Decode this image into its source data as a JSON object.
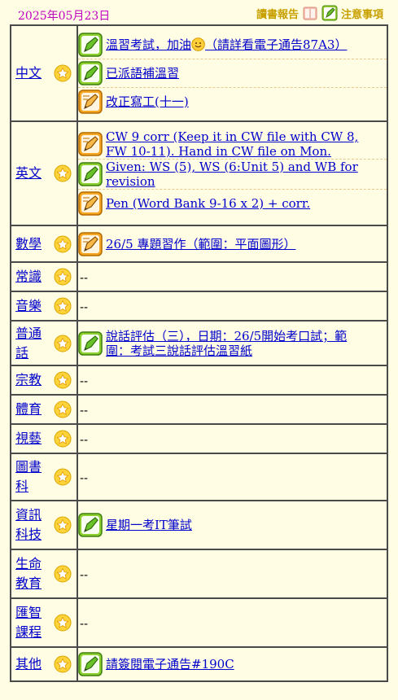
{
  "header": {
    "date": "2025年05月23日",
    "read_report_label": "讀書報告",
    "notice_label": "注意事項"
  },
  "subjects": [
    {
      "name": "中文",
      "items": [
        {
          "icon": "green-pencil",
          "text": "溫習考試，加油",
          "suffix": "（請詳看電子通告87A3）",
          "emoji": "smiley"
        },
        {
          "icon": "green-pencil",
          "text": "已派語補溫習"
        },
        {
          "icon": "orange-pencil",
          "text": "改正寫工(十一)"
        }
      ]
    },
    {
      "name": "英文",
      "items": [
        {
          "icon": "orange-pencil",
          "text": "CW 9 corr (Keep it in CW file with CW 8, FW 10-11). Hand in CW file on Mon."
        },
        {
          "icon": "green-pencil",
          "text": "Given: WS (5), WS (6:Unit 5) and WB for revision"
        },
        {
          "icon": "orange-pencil",
          "text": "Pen (Word Bank 9-16 x 2) + corr."
        }
      ]
    },
    {
      "name": "數學",
      "items": [
        {
          "icon": "orange-pencil",
          "text": "26/5 專題習作（範圍：平面圖形）"
        }
      ]
    },
    {
      "name": "常識",
      "items": [],
      "empty": "--"
    },
    {
      "name": "音樂",
      "items": [],
      "empty": "--"
    },
    {
      "name": "普通話",
      "items": [
        {
          "icon": "green-pencil",
          "text": "說話評估（三），日期：26/5開始考口試；範圍：考試三說話評估溫習紙"
        }
      ]
    },
    {
      "name": "宗教",
      "items": [],
      "empty": "--"
    },
    {
      "name": "體育",
      "items": [],
      "empty": "--"
    },
    {
      "name": "視藝",
      "items": [],
      "empty": "--"
    },
    {
      "name": "圖書科",
      "items": [],
      "empty": "--"
    },
    {
      "name": "資訊科技",
      "items": [
        {
          "icon": "green-pencil",
          "text": "星期一考IT筆試"
        }
      ]
    },
    {
      "name": "生命教育",
      "items": [],
      "empty": "--"
    },
    {
      "name": "匯智課程",
      "items": [],
      "empty": "--"
    },
    {
      "name": "其他",
      "items": [
        {
          "icon": "green-pencil",
          "text": "請簽閱電子通告#190C"
        }
      ]
    }
  ]
}
